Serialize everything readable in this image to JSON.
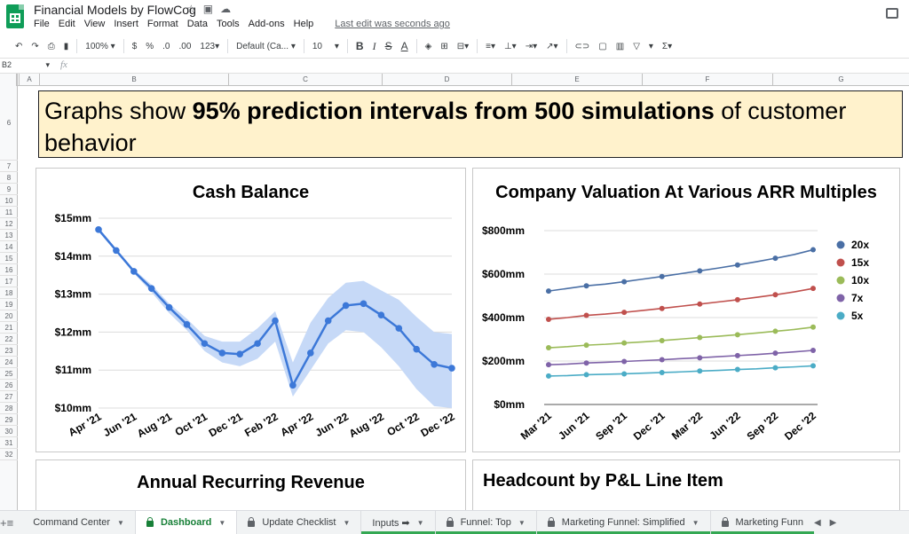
{
  "app": {
    "doc_title": "Financial Models by FlowCog",
    "menu": [
      "File",
      "Edit",
      "View",
      "Insert",
      "Format",
      "Data",
      "Tools",
      "Add-ons",
      "Help"
    ],
    "last_edit": "Last edit was seconds ago"
  },
  "toolbar": {
    "zoom": "100%",
    "currency": "$",
    "percent": "%",
    "dec_decrease": ".0",
    "dec_increase": ".00",
    "format_more": "123",
    "font": "Default (Ca...",
    "font_size": "10",
    "bold": "B",
    "italic": "I",
    "strike": "S",
    "text_color": "A",
    "functions": "Σ"
  },
  "formula_bar": {
    "cell_ref": "B2",
    "fx": "fx"
  },
  "columns": [
    "A",
    "B",
    "C",
    "D",
    "E",
    "F",
    "G"
  ],
  "rows": [
    "6",
    "7",
    "8",
    "9",
    "10",
    "11",
    "12",
    "13",
    "14",
    "15",
    "16",
    "17",
    "18",
    "19",
    "20",
    "21",
    "22",
    "23",
    "24",
    "25",
    "26",
    "27",
    "28",
    "29",
    "30",
    "31",
    "32"
  ],
  "banner": {
    "part1": "Graphs show ",
    "bold": "95% prediction intervals from 500 simulations",
    "part2": " of customer behavior"
  },
  "chart_titles": {
    "annual_recurring_revenue": "Annual Recurring Revenue",
    "headcount": "Headcount by P&L Line Item"
  },
  "chart_data": [
    {
      "type": "line",
      "title": "Cash Balance",
      "x": [
        "Apr '21",
        "May '21",
        "Jun '21",
        "Jul '21",
        "Aug '21",
        "Sep '21",
        "Oct '21",
        "Nov '21",
        "Dec '21",
        "Jan '22",
        "Feb '22",
        "Mar '22",
        "Apr '22",
        "May '22",
        "Jun '22",
        "Jul '22",
        "Aug '22",
        "Sep '22",
        "Oct '22",
        "Nov '22",
        "Dec '22"
      ],
      "tick_labels": [
        "Apr '21",
        "Jun '21",
        "Aug '21",
        "Oct '21",
        "Dec '21",
        "Feb '22",
        "Apr '22",
        "Jun '22",
        "Aug '22",
        "Oct '22",
        "Dec '22"
      ],
      "yticks": [
        "$10mm",
        "$11mm",
        "$12mm",
        "$13mm",
        "$14mm",
        "$15mm"
      ],
      "ylim": [
        10,
        15
      ],
      "series": [
        {
          "values": [
            14.7,
            14.15,
            13.6,
            13.15,
            12.65,
            12.2,
            11.7,
            11.45,
            11.42,
            11.7,
            12.3,
            10.6,
            11.45,
            12.3,
            12.7,
            12.75,
            12.45,
            12.1,
            11.55,
            11.15,
            11.05
          ]
        }
      ],
      "band_upper": [
        14.75,
        14.2,
        13.65,
        13.25,
        12.75,
        12.35,
        11.9,
        11.75,
        11.75,
        12.1,
        12.55,
        11.2,
        12.25,
        12.9,
        13.3,
        13.35,
        13.1,
        12.85,
        12.4,
        12.0,
        11.95
      ],
      "band_lower": [
        14.65,
        14.1,
        13.55,
        13.05,
        12.5,
        12.05,
        11.5,
        11.2,
        11.1,
        11.3,
        11.75,
        10.3,
        11.0,
        11.7,
        12.05,
        12.0,
        11.6,
        11.1,
        10.5,
        10.05,
        10.0
      ],
      "color": "#3c78d8",
      "band_color": "#c6d9f7",
      "grid": true
    },
    {
      "type": "line",
      "title": "Company Valuation At Various ARR Multiples",
      "x": [
        "Mar '21",
        "Apr '21",
        "Jun '21",
        "Jul '21",
        "Sep '21",
        "Oct '21",
        "Dec '21",
        "Jan '22",
        "Mar '22",
        "Apr '22",
        "Jun '22",
        "Jul '22",
        "Sep '22",
        "Oct '22",
        "Dec '22"
      ],
      "tick_labels": [
        "Mar '21",
        "Jun '21",
        "Sep '21",
        "Dec '21",
        "Mar '22",
        "Jun '22",
        "Sep '22",
        "Dec '22"
      ],
      "yticks": [
        "$0mm",
        "$200mm",
        "$400mm",
        "$600mm",
        "$800mm"
      ],
      "ylim": [
        0,
        800
      ],
      "legend": "right",
      "grid": true,
      "series": [
        {
          "name": "20x",
          "color": "#4a6fa5",
          "values": [
            522,
            534,
            546,
            554,
            565,
            577,
            589,
            602,
            615,
            628,
            642,
            657,
            673,
            690,
            712
          ]
        },
        {
          "name": "15x",
          "color": "#c0504d",
          "values": [
            392,
            400,
            410,
            416,
            424,
            433,
            442,
            452,
            462,
            472,
            482,
            493,
            505,
            518,
            534
          ]
        },
        {
          "name": "10x",
          "color": "#9bbb59",
          "values": [
            261,
            266,
            273,
            277,
            283,
            288,
            294,
            301,
            308,
            314,
            321,
            329,
            337,
            345,
            356
          ]
        },
        {
          "name": "7x",
          "color": "#7f63a8",
          "values": [
            183,
            186,
            191,
            194,
            198,
            202,
            206,
            211,
            215,
            220,
            225,
            230,
            236,
            242,
            249
          ]
        },
        {
          "name": "5x",
          "color": "#4bacc6",
          "values": [
            131,
            133,
            137,
            139,
            141,
            144,
            147,
            150,
            154,
            157,
            161,
            164,
            169,
            173,
            178
          ]
        }
      ]
    }
  ],
  "tabs": [
    {
      "label": "Command Center",
      "active": false,
      "locked": false
    },
    {
      "label": "Dashboard",
      "active": true,
      "locked": true
    },
    {
      "label": "Update Checklist",
      "active": false,
      "locked": true
    },
    {
      "label": "Inputs ➡",
      "active": false,
      "locked": false
    },
    {
      "label": "Funnel: Top",
      "active": false,
      "locked": true
    },
    {
      "label": "Marketing Funnel: Simplified",
      "active": false,
      "locked": true
    },
    {
      "label": "Marketing Funn",
      "active": false,
      "locked": true
    }
  ]
}
